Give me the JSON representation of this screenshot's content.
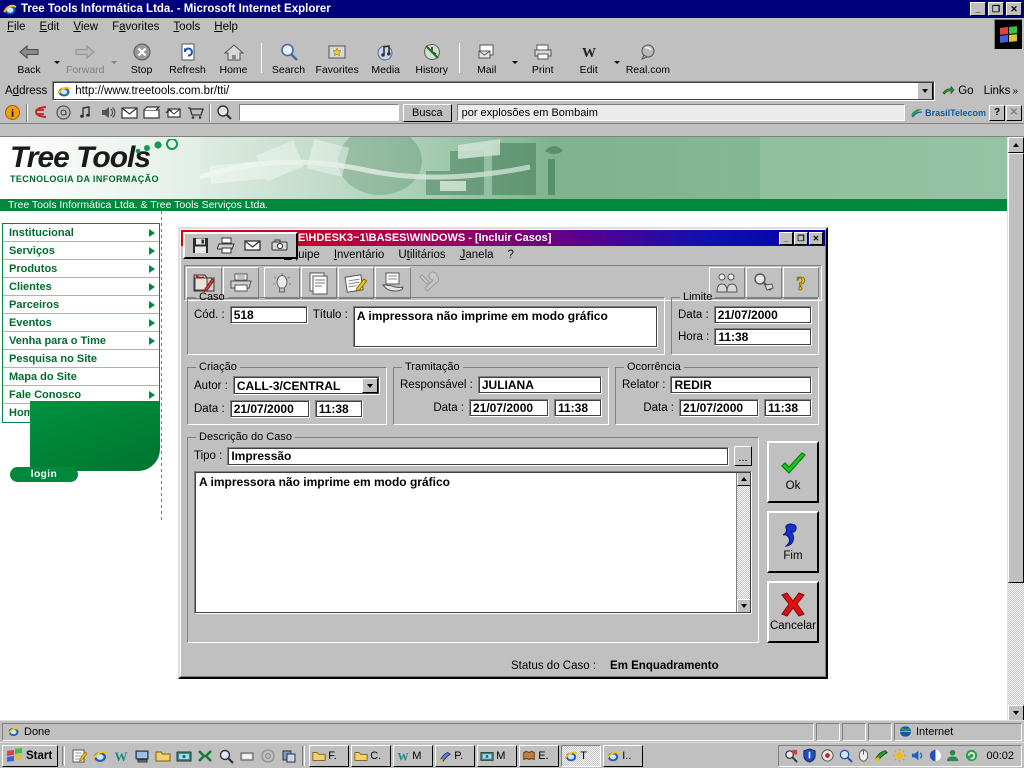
{
  "browser": {
    "title": "Tree Tools Informática Ltda. - Microsoft Internet Explorer",
    "title_icon": "ie-logo-icon",
    "window_buttons": {
      "minimize": "_",
      "maximize": "❐",
      "close": "✕"
    },
    "menu": [
      {
        "label": "File",
        "accel": "F"
      },
      {
        "label": "Edit",
        "accel": "E"
      },
      {
        "label": "View",
        "accel": "V"
      },
      {
        "label": "Favorites",
        "accel": "a"
      },
      {
        "label": "Tools",
        "accel": "T"
      },
      {
        "label": "Help",
        "accel": "H"
      }
    ],
    "toolbar": [
      {
        "label": "Back",
        "icon": "back-arrow-icon",
        "enabled": true,
        "dropdown": true
      },
      {
        "label": "Forward",
        "icon": "forward-arrow-icon",
        "enabled": false,
        "dropdown": true
      },
      {
        "label": "Stop",
        "icon": "stop-icon",
        "enabled": true
      },
      {
        "label": "Refresh",
        "icon": "refresh-icon",
        "enabled": true
      },
      {
        "label": "Home",
        "icon": "home-icon",
        "enabled": true
      },
      {
        "label": "Search",
        "icon": "search-icon",
        "enabled": true
      },
      {
        "label": "Favorites",
        "icon": "favorites-folder-icon",
        "enabled": true
      },
      {
        "label": "Media",
        "icon": "media-icon",
        "enabled": true
      },
      {
        "label": "History",
        "icon": "history-icon",
        "enabled": true
      },
      {
        "label": "Mail",
        "icon": "mail-icon",
        "enabled": true,
        "dropdown": true
      },
      {
        "label": "Print",
        "icon": "printer-icon",
        "enabled": true
      },
      {
        "label": "Edit",
        "icon": "word-edit-icon",
        "enabled": true,
        "dropdown": true
      },
      {
        "label": "Real.com",
        "icon": "realcom-icon",
        "enabled": true
      }
    ],
    "address": {
      "label": "Address",
      "icon": "ie-page-icon",
      "value": "http://www.treetools.com.br/tti/",
      "go_label": "Go",
      "links_label": "Links"
    },
    "extra_toolbar": {
      "icons": [
        "info-icon",
        "redirect-icon",
        "at-sign-icon",
        "music-note-icon",
        "speaker-icon",
        "envelope-icon",
        "clapperboard-icon",
        "send-mail-icon",
        "shopping-cart-icon",
        "search-magnifier-icon"
      ],
      "search_value": "",
      "search_button": "Busca",
      "ticker_text": "por explosões em Bombaim",
      "partner_logo": "BrasilTelecom",
      "help_button": "?",
      "close_button": "✕"
    },
    "status": {
      "text": "Done",
      "icon": "ie-doc-icon",
      "zone": "Internet",
      "zone_icon": "globe-icon"
    }
  },
  "webpage": {
    "logo": {
      "wordmark": "Tree Tools",
      "tagline": "TECNOLOGIA DA INFORMAÇÃO"
    },
    "strip": "Tree Tools Informática Ltda. & Tree Tools Serviços Ltda.",
    "nav": [
      {
        "label": "Institucional",
        "has_arrow": true
      },
      {
        "label": "Serviços",
        "has_arrow": true
      },
      {
        "label": "Produtos",
        "has_arrow": true
      },
      {
        "label": "Clientes",
        "has_arrow": true
      },
      {
        "label": "Parceiros",
        "has_arrow": true
      },
      {
        "label": "Eventos",
        "has_arrow": true
      },
      {
        "label": "Venha para o Time",
        "has_arrow": true
      },
      {
        "label": "Pesquisa no Site",
        "has_arrow": false
      },
      {
        "label": "Mapa do Site",
        "has_arrow": false
      },
      {
        "label": "Fale Conosco",
        "has_arrow": true
      },
      {
        "label": "Home",
        "has_arrow": false
      }
    ],
    "login_pill": "login",
    "colors": {
      "green": "#00883c",
      "dark_green": "#006b2d"
    }
  },
  "app_window": {
    "title": "Base R:\\SOFTWARE\\HDESK3~1\\BASES\\WINDOWS - [Incluir Casos]",
    "window_buttons": {
      "minimize": "_",
      "maximize": "❐",
      "close": "✕"
    },
    "floating_toolbar": {
      "icons": [
        "save-icon",
        "print-icon",
        "mail-icon",
        "camera-icon"
      ]
    },
    "menu": [
      {
        "label": "Equipe"
      },
      {
        "label": "Inventário"
      },
      {
        "label": "Utilitários"
      },
      {
        "label": "Janela"
      },
      {
        "label": "?"
      }
    ],
    "toolbar_icons": [
      "open-case-folder-icon",
      "print-case-icon",
      "lightbulb-icon",
      "documents-icon",
      "notepad-pencil-icon",
      "hand-documents-icon",
      "tools-icon",
      "people-icon",
      "search-tag-icon",
      "help-question-icon"
    ],
    "sections": {
      "caso": {
        "legend": "Caso",
        "cod_label": "Cód. :",
        "cod_value": "518",
        "titulo_label": "Título :",
        "titulo_value": "A impressora não imprime em modo gráfico"
      },
      "limite": {
        "legend": "Limite",
        "data_label": "Data :",
        "data_value": "21/07/2000",
        "hora_label": "Hora :",
        "hora_value": "11:38"
      },
      "criacao": {
        "legend": "Criação",
        "autor_label": "Autor :",
        "autor_value": "CALL-3/CENTRAL",
        "data_label": "Data :",
        "data_value": "21/07/2000",
        "hora_value": "11:38"
      },
      "tramitacao": {
        "legend": "Tramitação",
        "responsavel_label": "Responsável :",
        "responsavel_value": "JULIANA",
        "data_label": "Data :",
        "data_value": "21/07/2000",
        "hora_value": "11:38"
      },
      "ocorrencia": {
        "legend": "Ocorrência",
        "relator_label": "Relator :",
        "relator_value": "REDIR",
        "data_label": "Data :",
        "data_value": "21/07/2000",
        "hora_value": "11:38"
      },
      "descricao": {
        "legend": "Descrição do Caso",
        "tipo_label": "Tipo :",
        "tipo_value": "Impressão",
        "browse_button": "...",
        "memo_value": "A impressora não imprime em modo gráfico"
      }
    },
    "buttons": [
      {
        "label": "Ok",
        "icon": "green-check-icon"
      },
      {
        "label": "Fim",
        "icon": "blue-flag-icon"
      },
      {
        "label": "Cancelar",
        "icon": "red-x-icon"
      }
    ],
    "status": {
      "label": "Status do Caso :",
      "value": "Em Enquadramento"
    }
  },
  "taskbar": {
    "start_label": "Start",
    "start_icon": "windows-flag-icon",
    "quick_launch": [
      "notepad-icon",
      "ie-icon",
      "word-icon",
      "desktop-icon",
      "folder-icon",
      "media-icon",
      "excel-icon",
      "magnifier-icon",
      "screen-icon",
      "at-icon",
      "apps-icon"
    ],
    "tasks": [
      {
        "label": "F.",
        "icon": "folder-icon",
        "active": false
      },
      {
        "label": "C.",
        "icon": "folder-icon",
        "active": false
      },
      {
        "label": "M",
        "icon": "word-icon",
        "active": false
      },
      {
        "label": "P.",
        "icon": "paint-icon",
        "active": false
      },
      {
        "label": "M",
        "icon": "media-icon",
        "active": false
      },
      {
        "label": "E.",
        "icon": "book-icon",
        "active": false
      },
      {
        "label": "T",
        "icon": "ie-icon",
        "active": true
      },
      {
        "label": "I..",
        "icon": "ie-icon",
        "active": false
      }
    ],
    "tray_icons": [
      "magnifier-tray-icon",
      "shield-icon",
      "antivirus-icon",
      "magnifier2-icon",
      "mouse-icon",
      "paint-tray-icon",
      "sun-icon",
      "volume-icon",
      "power-icon",
      "user-icon",
      "refresh-tray-icon"
    ],
    "clock": "00:02"
  }
}
